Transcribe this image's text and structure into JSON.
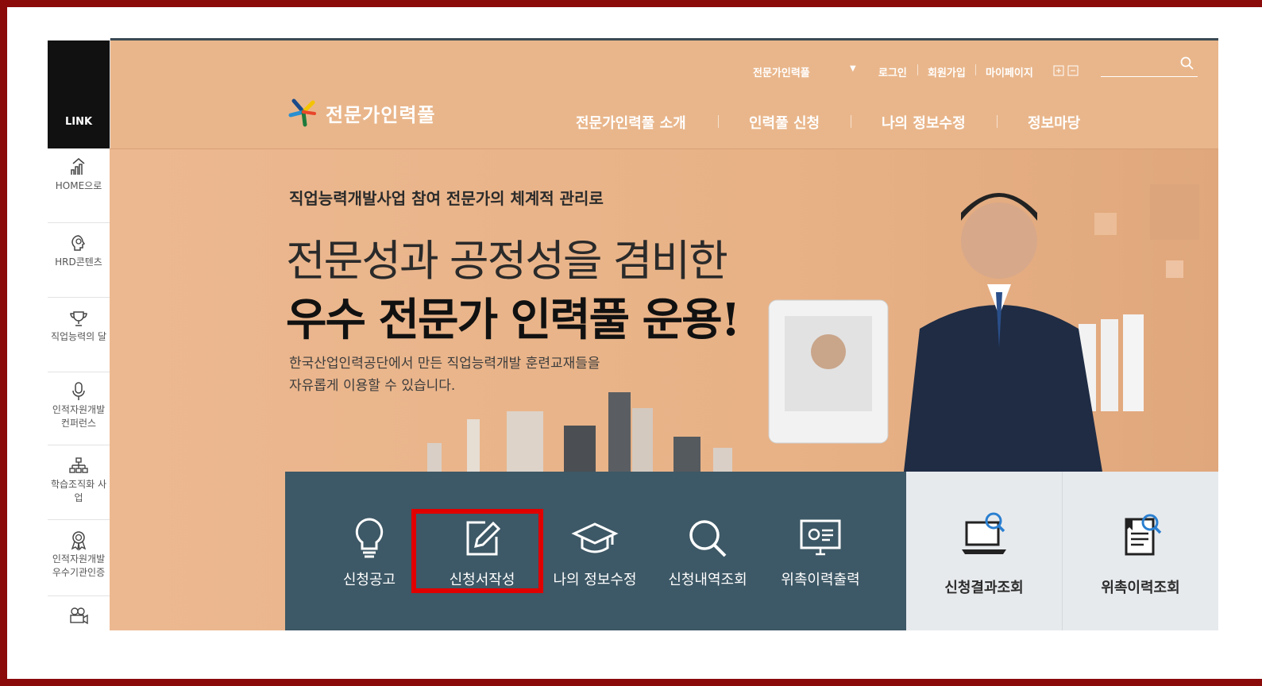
{
  "sidebar": {
    "title": "LINK",
    "items": [
      {
        "label": "HOME으로",
        "icon": "home-chart-icon"
      },
      {
        "label": "HRD콘텐츠",
        "icon": "head-lightbulb-icon"
      },
      {
        "label": "직업능력의 달",
        "icon": "trophy-icon"
      },
      {
        "label": "인적자원개발 컨퍼런스",
        "icon": "microphone-icon"
      },
      {
        "label": "학습조직화 사업",
        "icon": "org-chart-icon"
      },
      {
        "label": "인적자원개발 우수기관인증",
        "icon": "award-ribbon-icon"
      },
      {
        "label": "",
        "icon": "video-camera-icon"
      }
    ]
  },
  "header": {
    "dropdown_label": "전문가인력풀",
    "login": "로그인",
    "signup": "회원가입",
    "mypage": "마이페이지",
    "logo": "전문가인력풀",
    "nav": [
      "전문가인력풀 소개",
      "인력풀 신청",
      "나의 정보수정",
      "정보마당"
    ]
  },
  "hero": {
    "subtitle": "직업능력개발사업 참여 전문가의 체계적 관리로",
    "headline1": "전문성과 공정성을 겸비한",
    "headline2": "우수 전문가 인력풀 운용!",
    "desc1": "한국산업인력공단에서 만든 직업능력개발 훈련교재들을",
    "desc2": "자유롭게 이용할 수 있습니다."
  },
  "quick_menu": [
    {
      "label": "신청공고",
      "icon": "lightbulb-icon"
    },
    {
      "label": "신청서작성",
      "icon": "pencil-edit-icon",
      "highlighted": true
    },
    {
      "label": "나의 정보수정",
      "icon": "graduation-cap-icon"
    },
    {
      "label": "신청내역조회",
      "icon": "search-icon"
    },
    {
      "label": "위촉이력출력",
      "icon": "monitor-icon"
    }
  ],
  "right_menu": [
    {
      "label": "신청결과조회",
      "icon": "laptop-search-icon"
    },
    {
      "label": "위촉이력조회",
      "icon": "document-search-icon"
    }
  ],
  "colors": {
    "frame": "#8b0a0a",
    "hero_bg": "#e9b68b",
    "quick_menu_bg": "#3d5866",
    "highlight": "#e00000"
  }
}
